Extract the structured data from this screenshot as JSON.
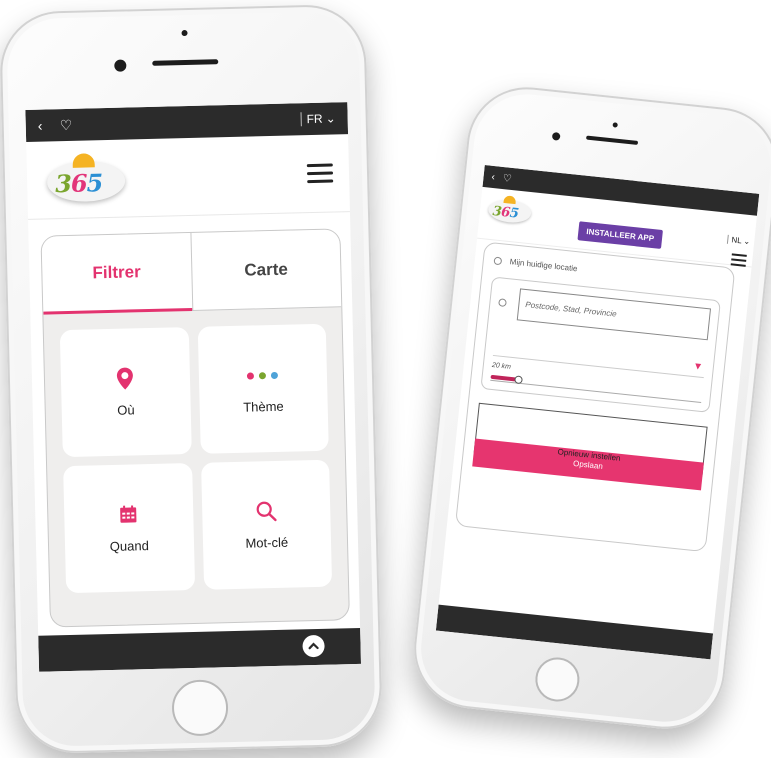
{
  "colors": {
    "accent": "#e3336f",
    "install": "#6b3fa6",
    "bar": "#2b2b2b",
    "dot1": "#e3336f",
    "dot2": "#7aa52e",
    "dot3": "#4fa3d8"
  },
  "left_phone": {
    "topbar": {
      "back_icon": "chevron-left-icon",
      "favorite_icon": "heart-icon",
      "lang": "FR"
    },
    "logo_text": {
      "d1": "3",
      "d2": "6",
      "d3": "5"
    },
    "tabs": {
      "filter": "Filtrer",
      "map": "Carte"
    },
    "cards": [
      {
        "icon": "location-pin-icon",
        "label": "Où"
      },
      {
        "icon": "three-dots-icon",
        "label": "Thème"
      },
      {
        "icon": "calendar-icon",
        "label": "Quand"
      },
      {
        "icon": "search-icon",
        "label": "Mot-clé"
      }
    ],
    "scroll_top_icon": "chevron-up-icon"
  },
  "right_phone": {
    "topbar": {
      "back_icon": "chevron-left-icon",
      "favorite_icon": "heart-icon"
    },
    "install_label": "INSTALLEER APP",
    "lang": "NL",
    "location_option": "Mijn huidige locatie",
    "postcode_placeholder": "Postcode, Stad, Provincie",
    "radius_label": "20 km",
    "radius_value_km": 20,
    "reset_label": "Opnieuw instellen",
    "save_label": "Opslaan"
  }
}
